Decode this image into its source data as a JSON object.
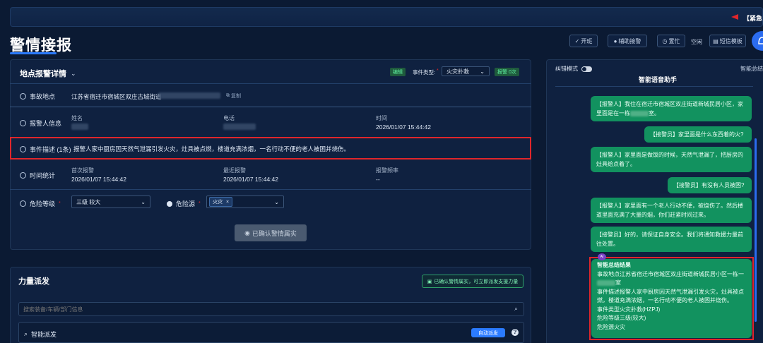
{
  "header": {
    "alarm_label": "【紧急",
    "page_title": "警情接报",
    "buttons": {
      "shift": "开班",
      "assist": "辅助接警",
      "busy": "置忙",
      "idle": "空闲",
      "sms_template": "短信模板"
    }
  },
  "incident_panel": {
    "title": "地点报警详情",
    "status_tag": "编辑",
    "event_type_label": "事件类型:",
    "event_type_value": "火灾扑救",
    "alarm_count": "报警 0次",
    "location": {
      "label": "事故地点",
      "value": "江苏省宿迁市宿城区双庄古城街道",
      "copy_label": "复制"
    },
    "caller": {
      "label": "报警人信息",
      "name_label": "姓名",
      "phone_label": "电话",
      "time_label": "时间",
      "time_value": "2026/01/07 15:44:42"
    },
    "description": {
      "label": "事件描述 (1条)",
      "value": "报警人家中厨房因天然气泄漏引发火灾，灶具被点燃，楼道充满浓烟，一名行动不便的老人被困并烧伤。"
    },
    "stats": {
      "label": "时间统计",
      "first_label": "首次报警",
      "first_value": "2026/01/07 15:44:42",
      "latest_label": "最近报警",
      "latest_value": "2026/01/07 15:44:42",
      "freq_label": "报警频率",
      "freq_value": "--"
    },
    "danger": {
      "level_label": "危险等级",
      "level_value": "三级 较大",
      "source_label": "危险源",
      "source_chip": "火灾"
    },
    "confirm_button": "已确认警情属实"
  },
  "dispatch_panel": {
    "title": "力量派发",
    "confirmed_badge": "已确认警情属实，可立即派发支援力量",
    "search_placeholder": "搜索装备/车辆/部门信息",
    "smart_label": "智能派发",
    "auto_button": "自动派发"
  },
  "assistant": {
    "mode_label": "纠错模式",
    "summary_tab": "智能总结",
    "title": "智能语音助手",
    "messages": [
      {
        "line1": "【报警人】我住在宿迁市宿城区双庄街道新城民居小区，家",
        "line2a": "里面是在一栋",
        "line2b": "室。"
      },
      {
        "text": "【接警员】家里面是什么东西着的火?"
      },
      {
        "line1": "【报警人】家里面是做饭的时候，天然气泄漏了，把厨房的",
        "line2": "灶具给点着了。"
      },
      {
        "text": "【接警员】有没有人员被困?"
      },
      {
        "line1": "【报警人】家里面有一个老人行动不便，被烧伤了。然后楼",
        "line2": "道里面充满了大量的烟，你们赶紧时间过来。"
      },
      {
        "line1": "【接警员】好的，请保证自身安全。我们将通知救援力量前",
        "line2": "往处置。"
      }
    ],
    "summary": {
      "badge": "AI",
      "heading": "智能总结结果",
      "loc_line1": "事故地点江苏省宿迁市宿城区双庄街道新城民居小区一栋一",
      "loc_line2": "室",
      "desc_line1": "事件描述报警人家中厨房因天然气泄漏引发火灾，灶具被点",
      "desc_line2": "燃，楼道充满浓烟，一名行动不便的老人被困并烧伤。",
      "type_line": "事件类型火灾扑救(HZPJ)",
      "level_line": "危险等级三级(较大)",
      "source_line": "危险源火灾"
    }
  },
  "colors": {
    "background": "#0b1a33",
    "panel": "#0f2140",
    "accent": "#2b7bff",
    "bubble": "#12925f",
    "highlight": "#e0262b"
  }
}
